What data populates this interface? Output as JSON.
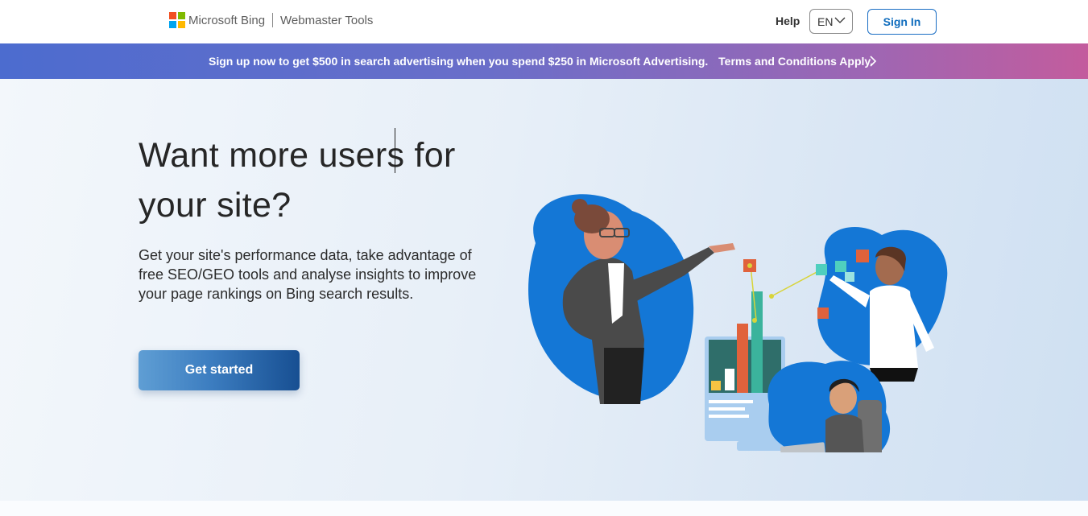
{
  "header": {
    "brand_name": "Microsoft Bing",
    "product_name": "Webmaster Tools",
    "help_label": "Help",
    "language_selected": "EN",
    "sign_in_label": "Sign In",
    "logo_colors": [
      "#f25022",
      "#7fba00",
      "#00a4ef",
      "#ffb900"
    ]
  },
  "promo": {
    "text": "Sign up now to get $500 in search advertising when you spend $250 in Microsoft Advertising.",
    "terms_label": "Terms and Conditions Apply.",
    "arrow_icon": "chevron-right-icon"
  },
  "hero": {
    "title": "Want more users for your site?",
    "description": "Get your site's performance data, take advantage of free SEO/GEO tools and analyse insights to improve your page rankings on Bing search results.",
    "cta_label": "Get started",
    "illustration": "people-analytics-illustration"
  },
  "colors": {
    "accent": "#0f6cbd",
    "promo_start": "#4c6ccf",
    "promo_end": "#c35c9d",
    "blob_blue": "#1477d6"
  }
}
